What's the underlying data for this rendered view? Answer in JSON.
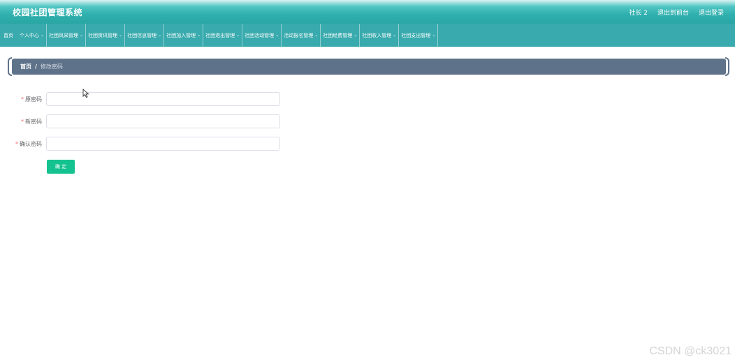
{
  "header": {
    "title": "校园社团管理系统",
    "user": "社长 2",
    "back_to_admin": "退出到前台",
    "logout": "退出登录"
  },
  "nav": {
    "home": "首页",
    "items": [
      "个人中心",
      "社团风采管理",
      "社团资讯管理",
      "社团信息管理",
      "社团加入管理",
      "社团退出管理",
      "社团活动管理",
      "活动报名管理",
      "社团经费管理",
      "社团收入管理",
      "社团支出管理"
    ]
  },
  "breadcrumb": {
    "home": "首页",
    "separator": "/",
    "current": "修改密码"
  },
  "form": {
    "fields": [
      {
        "label": "原密码",
        "value": ""
      },
      {
        "label": "新密码",
        "value": ""
      },
      {
        "label": "确认密码",
        "value": ""
      }
    ],
    "required_mark": "*",
    "submit_label": "确 定"
  },
  "watermark": "CSDN @ck3021",
  "colors": {
    "header": "#2fb0ae",
    "nav": "#39aaad",
    "breadcrumb": "#5e728a",
    "button": "#13c28f",
    "required": "#f56c6c"
  }
}
